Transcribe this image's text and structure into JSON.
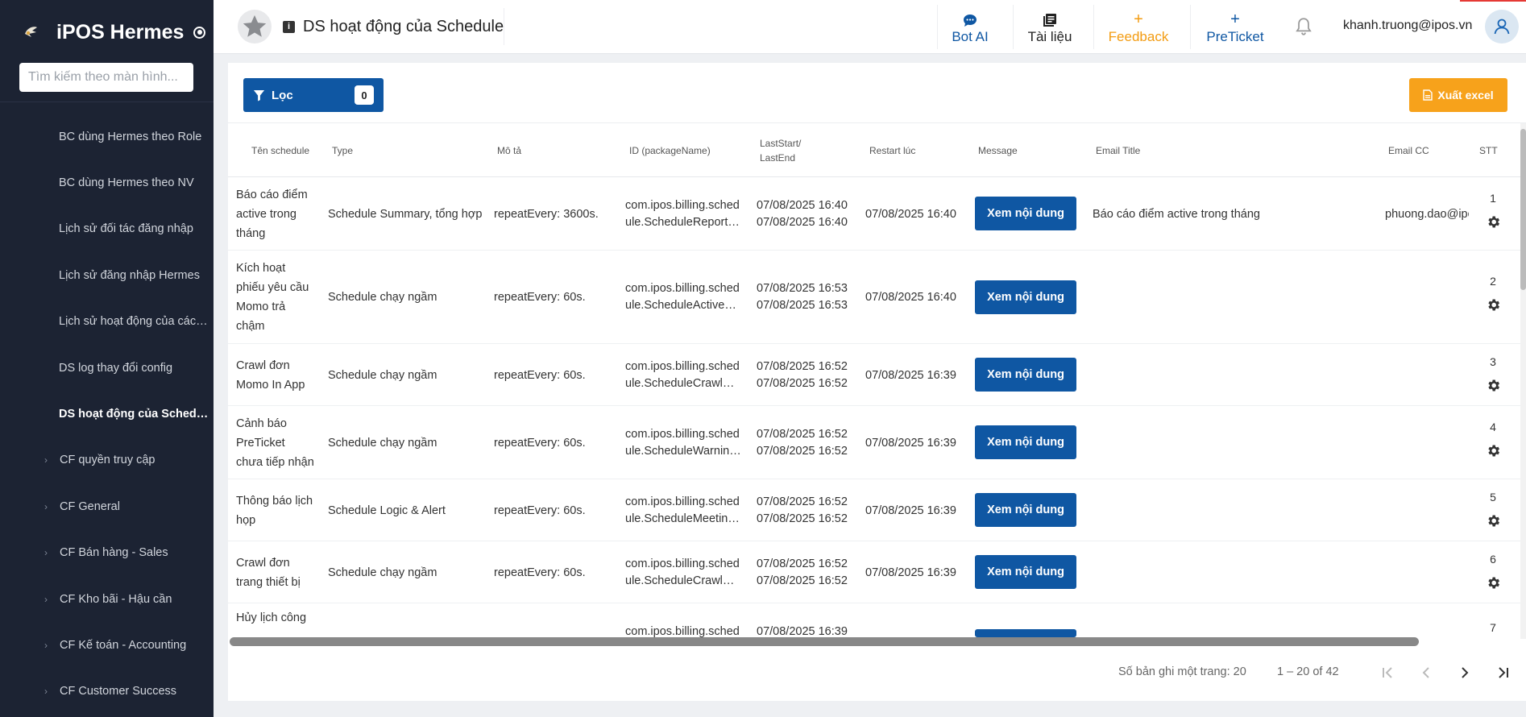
{
  "sidebar": {
    "brand": "iPOS Hermes",
    "search_placeholder": "Tìm kiếm theo màn hình...",
    "items": [
      {
        "label": "BC dùng Hermes theo Role"
      },
      {
        "label": "BC dùng Hermes theo NV"
      },
      {
        "label": "Lịch sử đối tác đăng nhập"
      },
      {
        "label": "Lịch sử đăng nhập Hermes"
      },
      {
        "label": "Lịch sử hoạt động của các t..."
      },
      {
        "label": "DS log thay đổi config"
      },
      {
        "label": "DS hoạt động của Schedule"
      }
    ],
    "groups": [
      {
        "label": "CF quyền truy cập"
      },
      {
        "label": "CF General"
      },
      {
        "label": "CF Bán hàng - Sales"
      },
      {
        "label": "CF Kho bãi - Hậu cần"
      },
      {
        "label": "CF Kế toán - Accounting"
      },
      {
        "label": "CF Customer Success"
      }
    ]
  },
  "header": {
    "title": "DS hoạt động của Schedule",
    "bot_ai": "Bot AI",
    "docs": "Tài liệu",
    "feedback": "Feedback",
    "preticket": "PreTicket",
    "user_email": "khanh.truong@ipos.vn"
  },
  "toolbar": {
    "filter_label": "Lọc",
    "filter_count": "0",
    "export_label": "Xuất excel"
  },
  "table": {
    "columns": {
      "name": "Tên schedule",
      "type": "Type",
      "desc": "Mô tả",
      "id_line1": "ID (packageName)",
      "last_line1": "LastStart/",
      "last_line2": "LastEnd",
      "restart": "Restart lúc",
      "message": "Message",
      "email_title": "Email Title",
      "email_cc": "Email CC",
      "stt": "STT"
    },
    "rows": [
      {
        "name": [
          "Báo cáo điểm",
          "active trong",
          "tháng"
        ],
        "type": "Schedule Summary, tổng hợp",
        "desc": "repeatEvery: 3600s.",
        "pkg1": "com.ipos.billing.sched",
        "pkg2": "ule.ScheduleReport…",
        "start": "07/08/2025 16:40",
        "end": "07/08/2025 16:40",
        "restart": "07/08/2025 16:40",
        "btn": "Xem nội dung",
        "email_title": "Báo cáo điểm active trong tháng",
        "email_cc": "phuong.dao@ipos.vn",
        "stt": "1"
      },
      {
        "name": [
          "Kích hoạt",
          "phiếu yêu cầu",
          "Momo trả",
          "chậm"
        ],
        "type": "Schedule chạy ngầm",
        "desc": "repeatEvery: 60s.",
        "pkg1": "com.ipos.billing.sched",
        "pkg2": "ule.ScheduleActiveR…",
        "start": "07/08/2025 16:53",
        "end": "07/08/2025 16:53",
        "restart": "07/08/2025 16:40",
        "btn": "Xem nội dung",
        "email_title": "",
        "email_cc": "",
        "stt": "2"
      },
      {
        "name": [
          "Crawl đơn",
          "Momo In App"
        ],
        "type": "Schedule chạy ngầm",
        "desc": "repeatEvery: 60s.",
        "pkg1": "com.ipos.billing.sched",
        "pkg2": "ule.ScheduleCrawlM…",
        "start": "07/08/2025 16:52",
        "end": "07/08/2025 16:52",
        "restart": "07/08/2025 16:39",
        "btn": "Xem nội dung",
        "email_title": "",
        "email_cc": "",
        "stt": "3"
      },
      {
        "name": [
          "Cảnh báo",
          "PreTicket",
          "chưa tiếp nhận"
        ],
        "type": "Schedule chạy ngầm",
        "desc": "repeatEvery: 60s.",
        "pkg1": "com.ipos.billing.sched",
        "pkg2": "ule.ScheduleWarnin…",
        "start": "07/08/2025 16:52",
        "end": "07/08/2025 16:52",
        "restart": "07/08/2025 16:39",
        "btn": "Xem nội dung",
        "email_title": "",
        "email_cc": "",
        "stt": "4"
      },
      {
        "name": [
          "Thông báo lịch",
          "họp"
        ],
        "type": "Schedule Logic & Alert",
        "desc": "repeatEvery: 60s.",
        "pkg1": "com.ipos.billing.sched",
        "pkg2": "ule.ScheduleMeeting…",
        "start": "07/08/2025 16:52",
        "end": "07/08/2025 16:52",
        "restart": "07/08/2025 16:39",
        "btn": "Xem nội dung",
        "email_title": "",
        "email_cc": "",
        "stt": "5"
      },
      {
        "name": [
          "Crawl đơn",
          "trang thiết bị"
        ],
        "type": "Schedule chạy ngầm",
        "desc": "repeatEvery: 60s.",
        "pkg1": "com.ipos.billing.sched",
        "pkg2": "ule.ScheduleCrawlW…",
        "start": "07/08/2025 16:52",
        "end": "07/08/2025 16:52",
        "restart": "07/08/2025 16:39",
        "btn": "Xem nội dung",
        "email_title": "",
        "email_cc": "",
        "stt": "6"
      },
      {
        "name": [
          "Hủy lịch công"
        ],
        "type": "",
        "desc": "",
        "pkg1": "com.ipos.billing.sched",
        "pkg2": "",
        "start": "07/08/2025 16:39",
        "end": "",
        "restart": "",
        "btn": "",
        "email_title": "",
        "email_cc": "",
        "stt": "7"
      }
    ]
  },
  "pagination": {
    "page_size_label": "Số bản ghi một trang: 20",
    "range_label": "1 – 20 of 42"
  },
  "colors": {
    "sidebar_bg": "#1c2333",
    "primary": "#0f57a3",
    "accent_orange": "#f7a21b",
    "preticket_blue": "#0f57a3"
  }
}
